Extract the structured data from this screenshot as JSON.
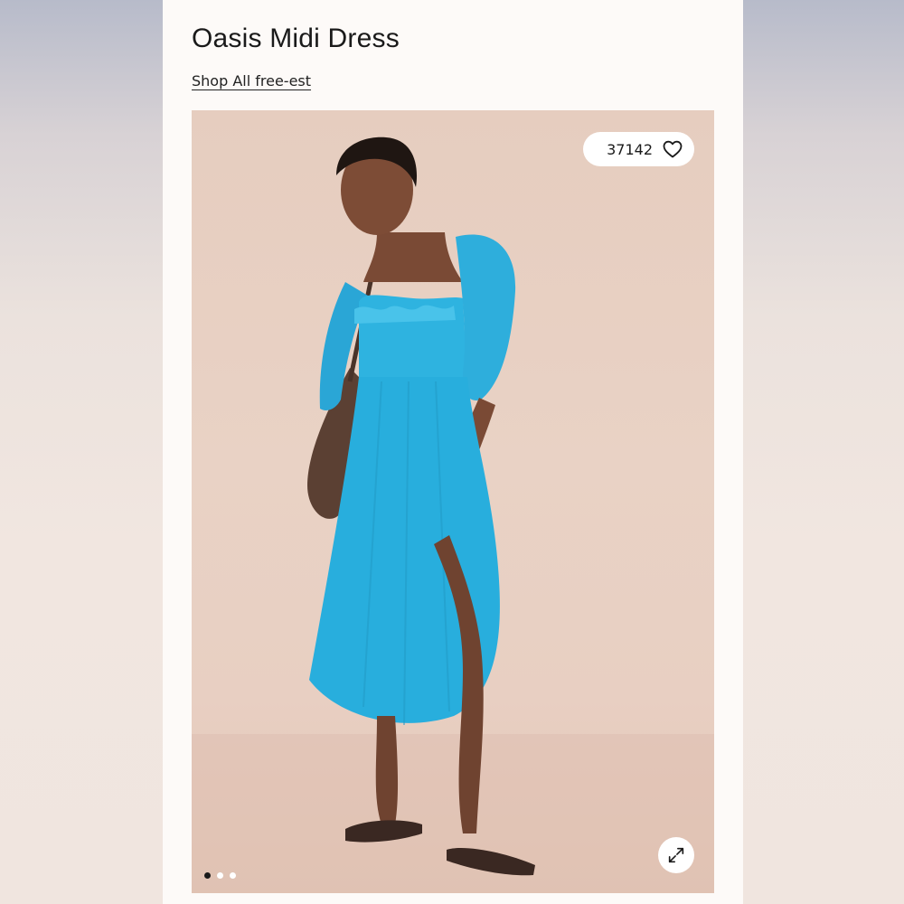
{
  "product": {
    "title": "Oasis Midi Dress",
    "shop_link": "Shop All free-est"
  },
  "gallery": {
    "likes_count": "37142",
    "heart_icon": "heart-outline-icon",
    "expand_icon": "expand-arrows-icon",
    "dots": [
      "active",
      "inactive",
      "inactive"
    ],
    "current_image_index": 1,
    "image_count": 3
  },
  "colors": {
    "dress": "#2bb1df",
    "background": "#e8cfc2",
    "card": "#fdfaf8"
  }
}
